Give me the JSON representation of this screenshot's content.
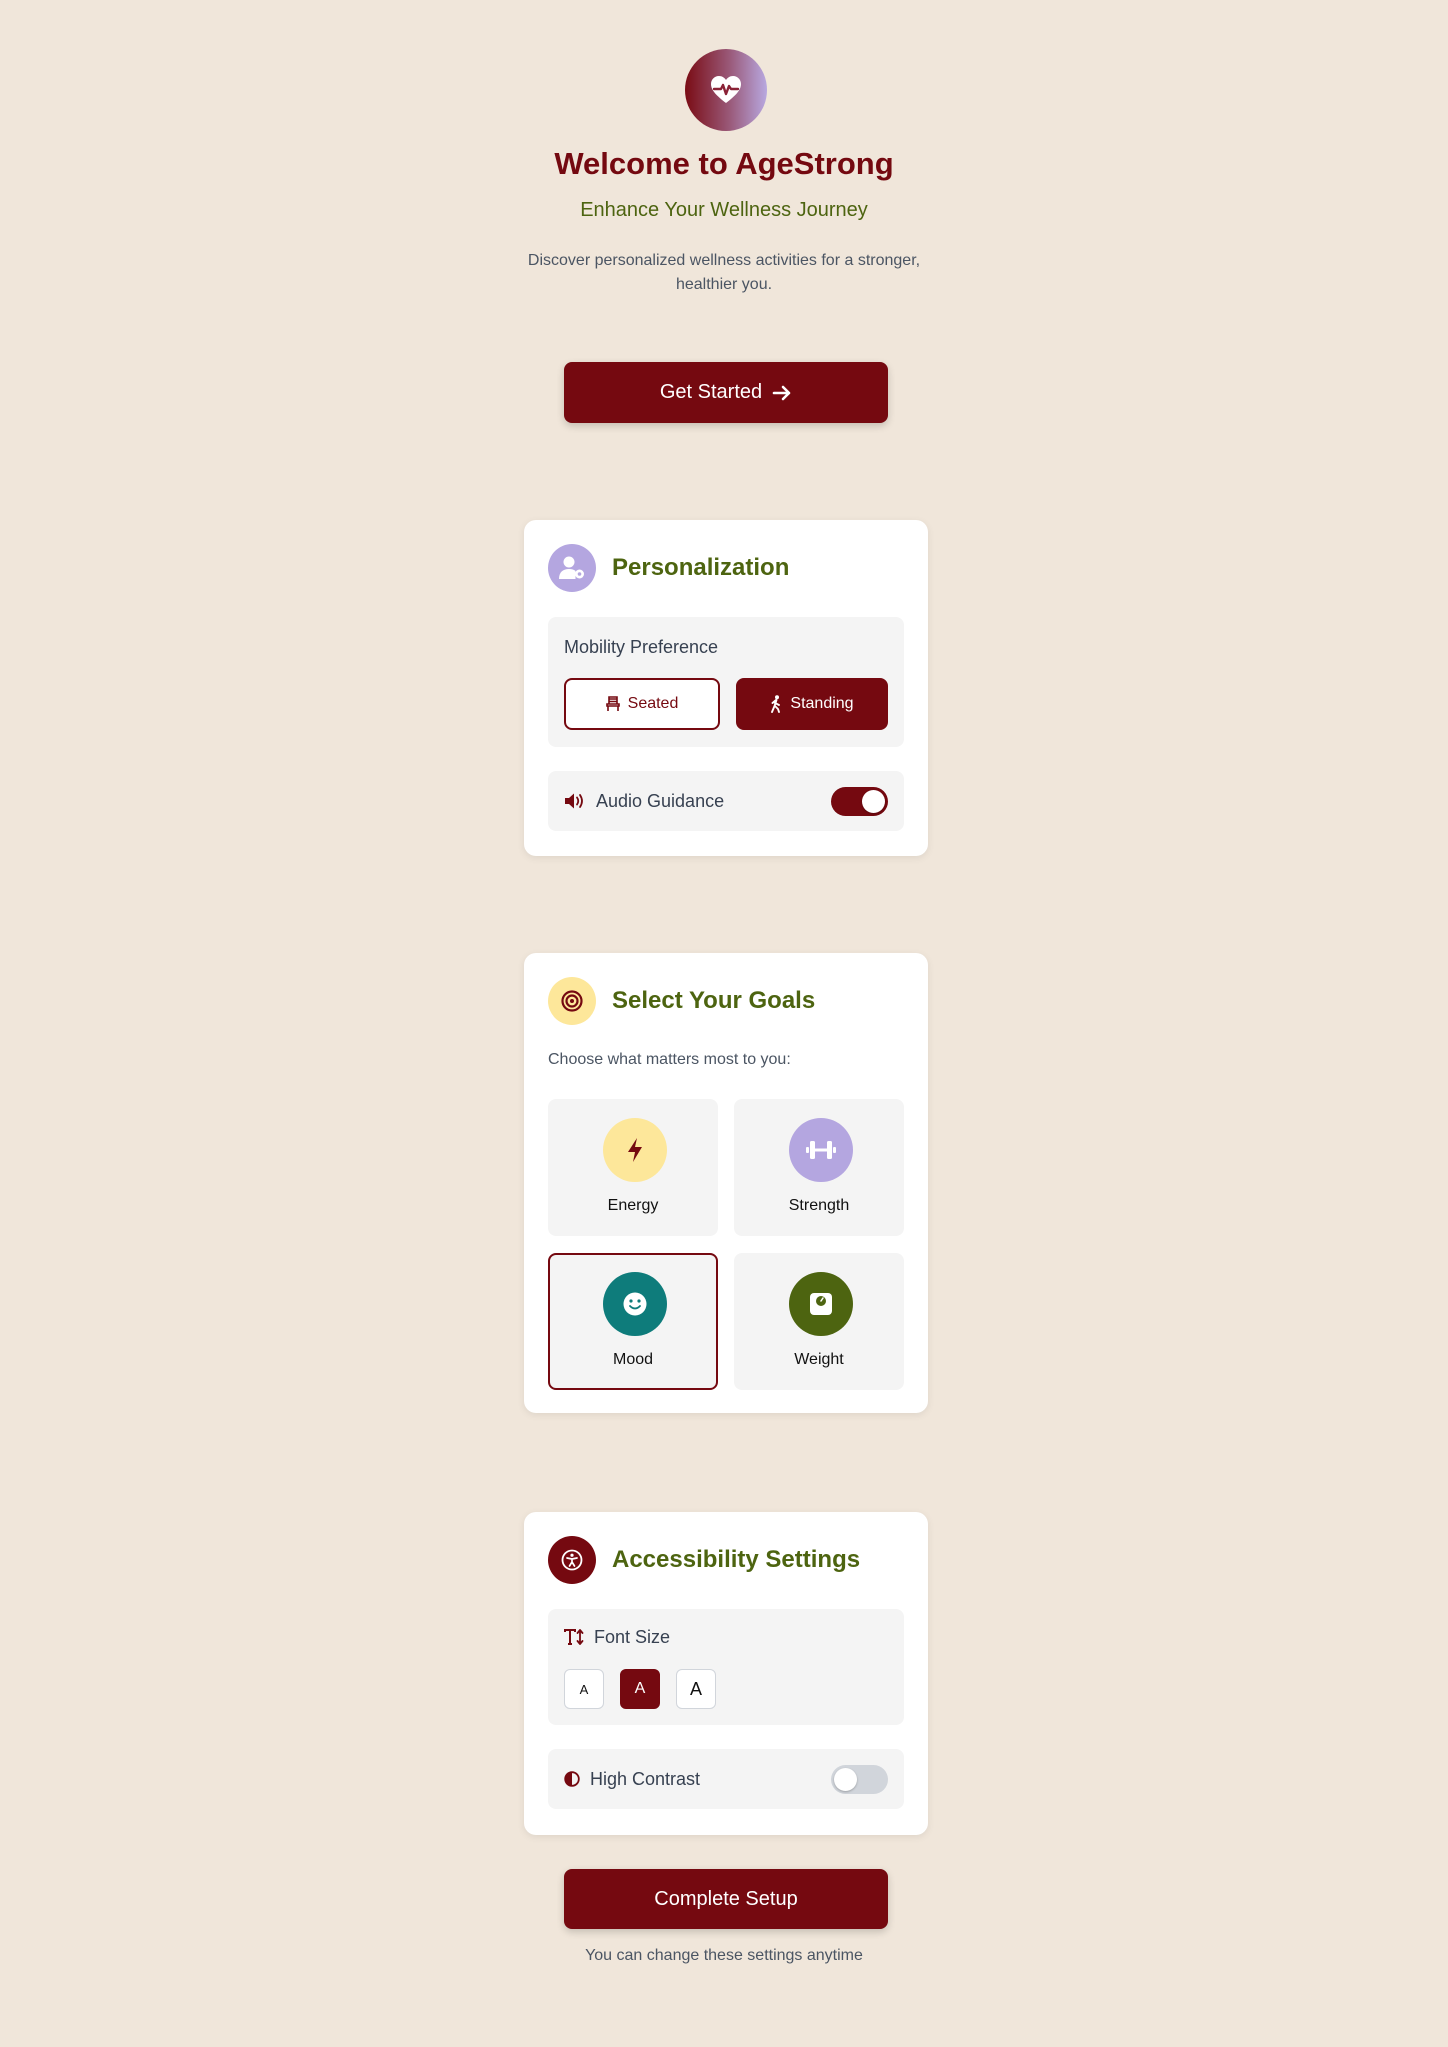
{
  "hero": {
    "logo_icon": "heart-pulse-icon",
    "title": "Welcome to AgeStrong",
    "subtitle": "Enhance Your Wellness Journey",
    "description": "Discover personalized wellness activities for a stronger, healthier you.",
    "cta_label": "Get Started",
    "cta_icon": "arrow-right-icon"
  },
  "personalization": {
    "title": "Personalization",
    "icon": "user-gear-icon",
    "mobility": {
      "label": "Mobility Preference",
      "options": [
        {
          "label": "Seated",
          "icon": "chair-icon",
          "selected": false
        },
        {
          "label": "Standing",
          "icon": "walking-person-icon",
          "selected": true
        }
      ]
    },
    "audio": {
      "label": "Audio Guidance",
      "icon": "speaker-icon",
      "enabled": true
    }
  },
  "goals": {
    "title": "Select Your Goals",
    "icon": "target-icon",
    "hint": "Choose what matters most to you:",
    "items": [
      {
        "label": "Energy",
        "icon": "bolt-icon",
        "color": "#fde79a",
        "selected": false
      },
      {
        "label": "Strength",
        "icon": "dumbbell-icon",
        "color": "#b4a6e0",
        "selected": false
      },
      {
        "label": "Mood",
        "icon": "smile-icon",
        "color": "#0e7c7b",
        "selected": true
      },
      {
        "label": "Weight",
        "icon": "scale-icon",
        "color": "#4d6410",
        "selected": false
      }
    ]
  },
  "accessibility": {
    "title": "Accessibility Settings",
    "icon": "universal-access-icon",
    "font_size": {
      "label": "Font Size",
      "icon": "text-height-icon",
      "options": [
        {
          "label": "A",
          "active": false
        },
        {
          "label": "A",
          "active": true
        },
        {
          "label": "A",
          "active": false
        }
      ]
    },
    "high_contrast": {
      "label": "High Contrast",
      "icon": "contrast-icon",
      "enabled": false
    }
  },
  "footer": {
    "complete_label": "Complete Setup",
    "note": "You can change these settings anytime"
  },
  "colors": {
    "background": "#f0e6da",
    "primary": "#750910",
    "accent_green": "#4d6410",
    "lavender": "#b4a6e0",
    "yellow": "#fde79a",
    "teal": "#0e7c7b"
  }
}
